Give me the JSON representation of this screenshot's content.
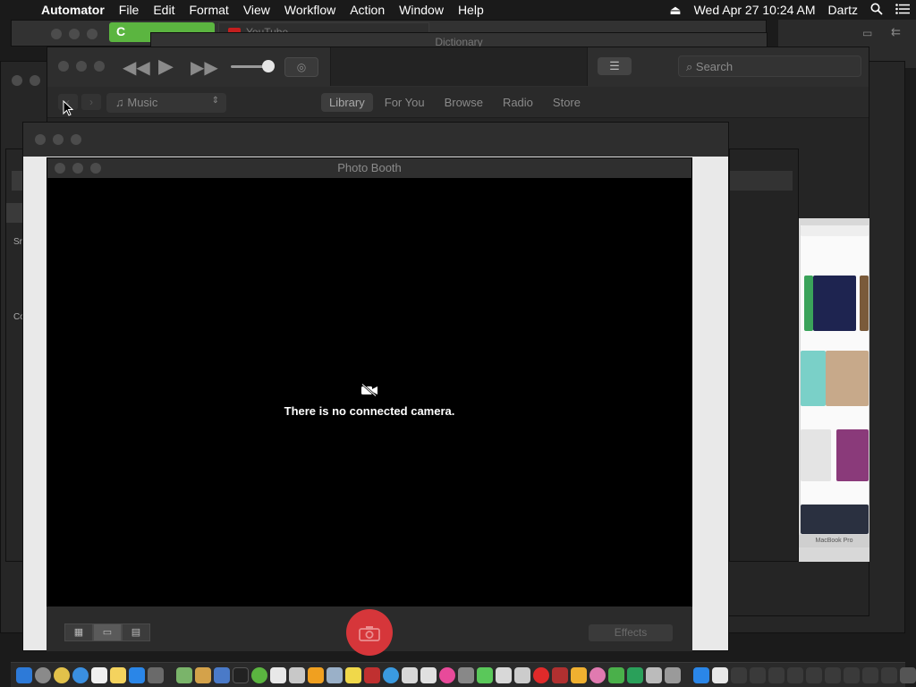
{
  "menubar": {
    "app_name": "Automator",
    "items": [
      "File",
      "Edit",
      "Format",
      "View",
      "Workflow",
      "Action",
      "Window",
      "Help"
    ],
    "clock": "Wed Apr 27  10:24 AM",
    "user": "Dartz",
    "icons": [
      "apple-icon",
      "eject-icon",
      "spotlight-icon",
      "notification-center-icon"
    ]
  },
  "background_windows": {
    "safari_tab_text": "C",
    "youtube_tab_title": "YouTube",
    "dictionary_title": "Dictionary"
  },
  "itunes": {
    "media_selector": "Music",
    "search_placeholder": "Search",
    "tabs": [
      {
        "label": "Library",
        "active": true
      },
      {
        "label": "For You",
        "active": false
      },
      {
        "label": "Browse",
        "active": false
      },
      {
        "label": "Radio",
        "active": false
      },
      {
        "label": "Store",
        "active": false
      }
    ]
  },
  "photo_booth": {
    "title": "Photo Booth",
    "message": "There is no connected camera.",
    "effects_label": "Effects",
    "view_modes": [
      "grid-view",
      "single-view",
      "filmstrip-view"
    ],
    "selected_view": "single-view"
  },
  "sidebar_fragments": [
    "Sr",
    "Co"
  ],
  "laptop_caption": "MacBook Pro",
  "colors": {
    "shutter_red": "#d6363a",
    "menubar_bg": "#1a1a1a",
    "window_bg": "#2a2a2a"
  }
}
